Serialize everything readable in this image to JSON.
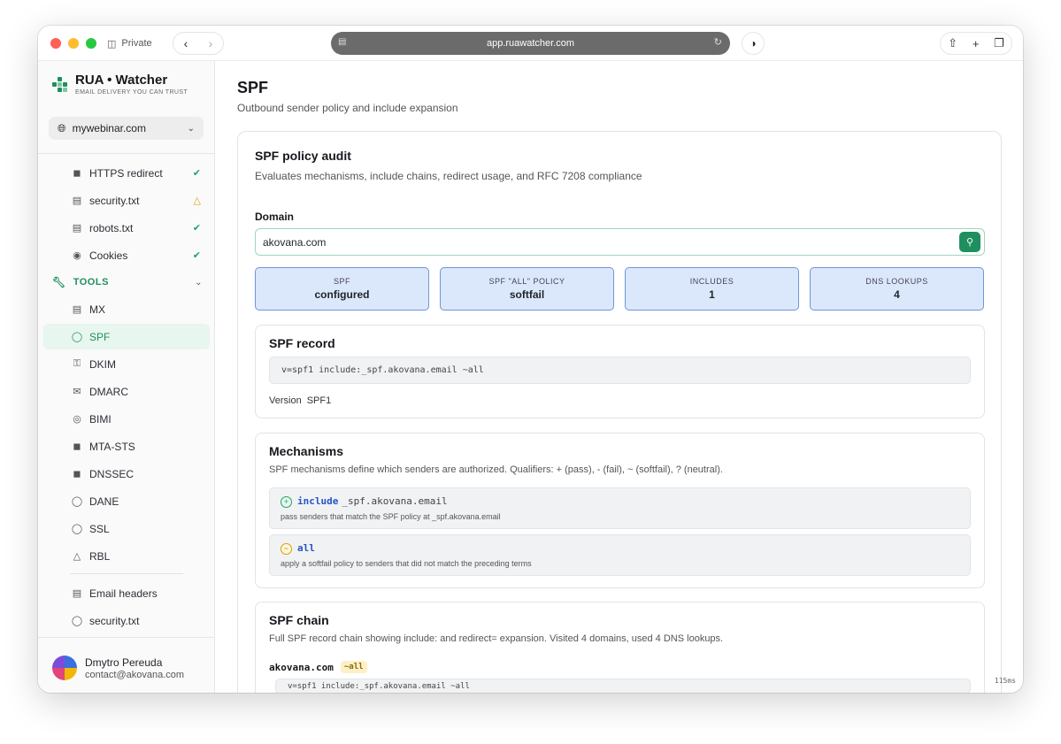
{
  "browser": {
    "private_label": "Private",
    "url": "app.ruawatcher.com"
  },
  "brand": {
    "name": "RUA • Watcher",
    "tagline": "EMAIL DELIVERY YOU CAN TRUST",
    "accent": "#1f8f5f"
  },
  "domain_select": {
    "value": "mywebinar.com"
  },
  "sidebar": {
    "checks": [
      {
        "label": "HTTPS redirect",
        "status": "ok"
      },
      {
        "label": "security.txt",
        "status": "warn"
      },
      {
        "label": "robots.txt",
        "status": "ok"
      },
      {
        "label": "Cookies",
        "status": "ok"
      }
    ],
    "tools_label": "TOOLS",
    "tools": [
      {
        "label": "MX",
        "icon": "server-icon"
      },
      {
        "label": "SPF",
        "icon": "shield-icon"
      },
      {
        "label": "DKIM",
        "icon": "key-icon"
      },
      {
        "label": "DMARC",
        "icon": "mail-icon"
      },
      {
        "label": "BIMI",
        "icon": "fingerprint-icon"
      },
      {
        "label": "MTA-STS",
        "icon": "lock-icon"
      },
      {
        "label": "DNSSEC",
        "icon": "lock-icon"
      },
      {
        "label": "DANE",
        "icon": "shield-icon"
      },
      {
        "label": "SSL",
        "icon": "shield-check-icon"
      },
      {
        "label": "RBL",
        "icon": "warning-icon"
      }
    ],
    "extra": [
      {
        "label": "Email headers",
        "icon": "document-icon"
      },
      {
        "label": "security.txt",
        "icon": "shield-icon"
      }
    ],
    "user": {
      "name": "Dmytro Pereuda",
      "email": "contact@akovana.com"
    }
  },
  "page": {
    "title": "SPF",
    "subtitle": "Outbound sender policy and include expansion"
  },
  "audit": {
    "title": "SPF policy audit",
    "subtitle": "Evaluates mechanisms, include chains, redirect usage, and RFC 7208 compliance",
    "domain_label": "Domain",
    "domain_value": "akovana.com",
    "stats": [
      {
        "label": "SPF",
        "value": "configured"
      },
      {
        "label": "SPF \"ALL\" POLICY",
        "value": "softfail"
      },
      {
        "label": "INCLUDES",
        "value": "1"
      },
      {
        "label": "DNS LOOKUPS",
        "value": "4"
      }
    ]
  },
  "record": {
    "title": "SPF record",
    "value": "v=spf1 include:_spf.akovana.email ~all",
    "version_label": "Version",
    "version_value": "SPF1"
  },
  "mechanisms": {
    "title": "Mechanisms",
    "subtitle": "SPF mechanisms define which senders are authorized. Qualifiers: + (pass), - (fail), ~ (softfail), ? (neutral).",
    "items": [
      {
        "qualifier": "+",
        "keyword": "include",
        "value": "_spf.akovana.email",
        "desc": "pass senders that match the SPF policy at _spf.akovana.email"
      },
      {
        "qualifier": "~",
        "keyword": "all",
        "value": "",
        "desc": "apply a softfail policy to senders that did not match the preceding terms"
      }
    ]
  },
  "chain": {
    "title": "SPF chain",
    "subtitle": "Full SPF record chain showing include: and redirect= expansion. Visited 4 domains, used 4 DNS lookups.",
    "domain": "akovana.com",
    "tag": "~all",
    "record": "v=spf1 include:_spf.akovana.email ~all"
  },
  "latency": "115ms"
}
